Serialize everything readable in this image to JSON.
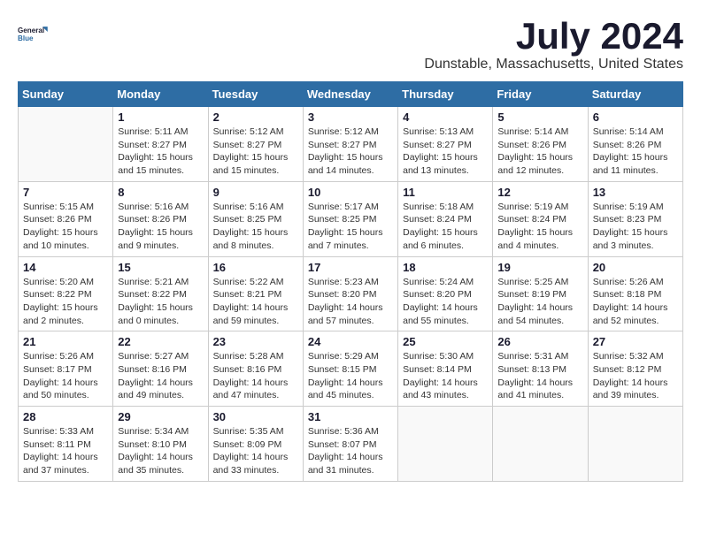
{
  "logo": {
    "line1": "General",
    "line2": "Blue"
  },
  "title": "July 2024",
  "location": "Dunstable, Massachusetts, United States",
  "days_of_week": [
    "Sunday",
    "Monday",
    "Tuesday",
    "Wednesday",
    "Thursday",
    "Friday",
    "Saturday"
  ],
  "weeks": [
    [
      {
        "day": "",
        "info": ""
      },
      {
        "day": "1",
        "info": "Sunrise: 5:11 AM\nSunset: 8:27 PM\nDaylight: 15 hours\nand 15 minutes."
      },
      {
        "day": "2",
        "info": "Sunrise: 5:12 AM\nSunset: 8:27 PM\nDaylight: 15 hours\nand 15 minutes."
      },
      {
        "day": "3",
        "info": "Sunrise: 5:12 AM\nSunset: 8:27 PM\nDaylight: 15 hours\nand 14 minutes."
      },
      {
        "day": "4",
        "info": "Sunrise: 5:13 AM\nSunset: 8:27 PM\nDaylight: 15 hours\nand 13 minutes."
      },
      {
        "day": "5",
        "info": "Sunrise: 5:14 AM\nSunset: 8:26 PM\nDaylight: 15 hours\nand 12 minutes."
      },
      {
        "day": "6",
        "info": "Sunrise: 5:14 AM\nSunset: 8:26 PM\nDaylight: 15 hours\nand 11 minutes."
      }
    ],
    [
      {
        "day": "7",
        "info": "Sunrise: 5:15 AM\nSunset: 8:26 PM\nDaylight: 15 hours\nand 10 minutes."
      },
      {
        "day": "8",
        "info": "Sunrise: 5:16 AM\nSunset: 8:26 PM\nDaylight: 15 hours\nand 9 minutes."
      },
      {
        "day": "9",
        "info": "Sunrise: 5:16 AM\nSunset: 8:25 PM\nDaylight: 15 hours\nand 8 minutes."
      },
      {
        "day": "10",
        "info": "Sunrise: 5:17 AM\nSunset: 8:25 PM\nDaylight: 15 hours\nand 7 minutes."
      },
      {
        "day": "11",
        "info": "Sunrise: 5:18 AM\nSunset: 8:24 PM\nDaylight: 15 hours\nand 6 minutes."
      },
      {
        "day": "12",
        "info": "Sunrise: 5:19 AM\nSunset: 8:24 PM\nDaylight: 15 hours\nand 4 minutes."
      },
      {
        "day": "13",
        "info": "Sunrise: 5:19 AM\nSunset: 8:23 PM\nDaylight: 15 hours\nand 3 minutes."
      }
    ],
    [
      {
        "day": "14",
        "info": "Sunrise: 5:20 AM\nSunset: 8:22 PM\nDaylight: 15 hours\nand 2 minutes."
      },
      {
        "day": "15",
        "info": "Sunrise: 5:21 AM\nSunset: 8:22 PM\nDaylight: 15 hours\nand 0 minutes."
      },
      {
        "day": "16",
        "info": "Sunrise: 5:22 AM\nSunset: 8:21 PM\nDaylight: 14 hours\nand 59 minutes."
      },
      {
        "day": "17",
        "info": "Sunrise: 5:23 AM\nSunset: 8:20 PM\nDaylight: 14 hours\nand 57 minutes."
      },
      {
        "day": "18",
        "info": "Sunrise: 5:24 AM\nSunset: 8:20 PM\nDaylight: 14 hours\nand 55 minutes."
      },
      {
        "day": "19",
        "info": "Sunrise: 5:25 AM\nSunset: 8:19 PM\nDaylight: 14 hours\nand 54 minutes."
      },
      {
        "day": "20",
        "info": "Sunrise: 5:26 AM\nSunset: 8:18 PM\nDaylight: 14 hours\nand 52 minutes."
      }
    ],
    [
      {
        "day": "21",
        "info": "Sunrise: 5:26 AM\nSunset: 8:17 PM\nDaylight: 14 hours\nand 50 minutes."
      },
      {
        "day": "22",
        "info": "Sunrise: 5:27 AM\nSunset: 8:16 PM\nDaylight: 14 hours\nand 49 minutes."
      },
      {
        "day": "23",
        "info": "Sunrise: 5:28 AM\nSunset: 8:16 PM\nDaylight: 14 hours\nand 47 minutes."
      },
      {
        "day": "24",
        "info": "Sunrise: 5:29 AM\nSunset: 8:15 PM\nDaylight: 14 hours\nand 45 minutes."
      },
      {
        "day": "25",
        "info": "Sunrise: 5:30 AM\nSunset: 8:14 PM\nDaylight: 14 hours\nand 43 minutes."
      },
      {
        "day": "26",
        "info": "Sunrise: 5:31 AM\nSunset: 8:13 PM\nDaylight: 14 hours\nand 41 minutes."
      },
      {
        "day": "27",
        "info": "Sunrise: 5:32 AM\nSunset: 8:12 PM\nDaylight: 14 hours\nand 39 minutes."
      }
    ],
    [
      {
        "day": "28",
        "info": "Sunrise: 5:33 AM\nSunset: 8:11 PM\nDaylight: 14 hours\nand 37 minutes."
      },
      {
        "day": "29",
        "info": "Sunrise: 5:34 AM\nSunset: 8:10 PM\nDaylight: 14 hours\nand 35 minutes."
      },
      {
        "day": "30",
        "info": "Sunrise: 5:35 AM\nSunset: 8:09 PM\nDaylight: 14 hours\nand 33 minutes."
      },
      {
        "day": "31",
        "info": "Sunrise: 5:36 AM\nSunset: 8:07 PM\nDaylight: 14 hours\nand 31 minutes."
      },
      {
        "day": "",
        "info": ""
      },
      {
        "day": "",
        "info": ""
      },
      {
        "day": "",
        "info": ""
      }
    ]
  ]
}
